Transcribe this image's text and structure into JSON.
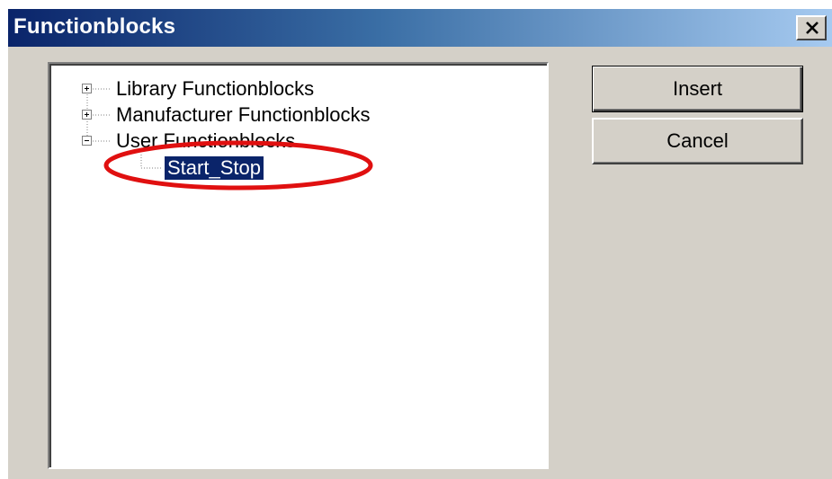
{
  "window": {
    "title": "Functionblocks"
  },
  "tree": {
    "nodes": [
      {
        "label": "Library Functionblocks",
        "expander": "+"
      },
      {
        "label": "Manufacturer Functionblocks",
        "expander": "+"
      },
      {
        "label": "User Functionblocks",
        "expander": "-"
      }
    ],
    "children": [
      {
        "label": "Start_Stop",
        "selected": true
      }
    ]
  },
  "buttons": {
    "insert_label": "Insert",
    "cancel_label": "Cancel"
  },
  "colors": {
    "selection": "#0a246a",
    "annotation": "#e01010",
    "dialog_face": "#d4d0c8"
  }
}
